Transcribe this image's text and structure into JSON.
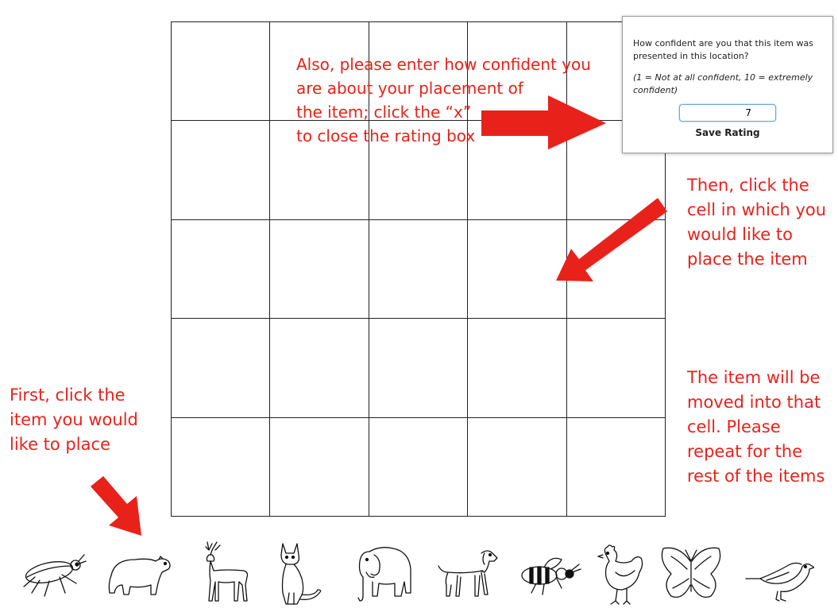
{
  "instructions": {
    "confidence": "Also, please enter how confident you\nare about your placement of\nthe item; click the “x”\nto close the rating box",
    "click_cell": "Then, click the\ncell in which you\nwould like to\nplace the item",
    "moved": "The item will be\nmoved into that\ncell. Please\nrepeat for the\nrest of the items",
    "first": "First, click the\nitem you would\nlike to place"
  },
  "rating_box": {
    "question": "How confident are you that this item was presented in this location?",
    "scale_hint": "(1 = Not at all confident, 10 = extremely confident)",
    "input_value": "7",
    "save_label": "Save Rating"
  },
  "grid": {
    "rows": 5,
    "columns": 5
  },
  "items": [
    {
      "name": "beetle",
      "icon": "beetle-icon"
    },
    {
      "name": "bear",
      "icon": "bear-icon"
    },
    {
      "name": "deer",
      "icon": "deer-icon"
    },
    {
      "name": "cat",
      "icon": "cat-icon"
    },
    {
      "name": "elephant",
      "icon": "elephant-icon"
    },
    {
      "name": "dog",
      "icon": "dog-icon"
    },
    {
      "name": "bee",
      "icon": "bee-icon"
    },
    {
      "name": "chicken",
      "icon": "chicken-icon"
    },
    {
      "name": "butterfly",
      "icon": "butterfly-icon"
    },
    {
      "name": "bird",
      "icon": "bird-icon"
    }
  ],
  "colors": {
    "annotation": "#e8221b",
    "grid_line": "#222222",
    "input_focus": "#6aa6d6"
  }
}
